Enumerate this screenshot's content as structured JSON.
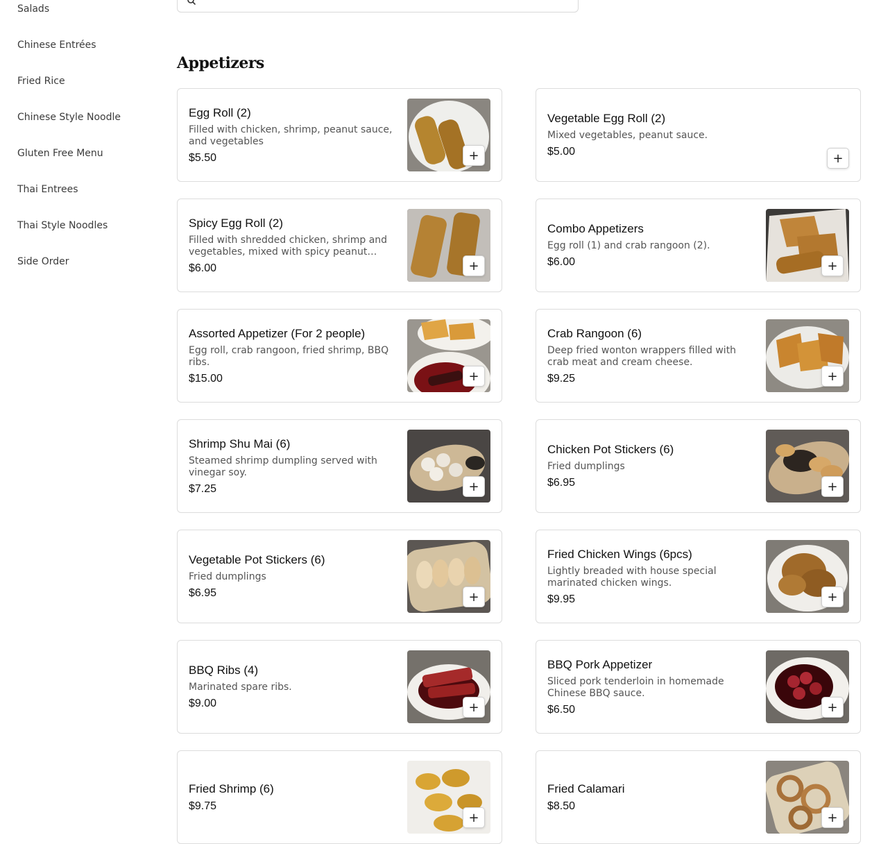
{
  "sidebar": {
    "items": [
      {
        "label": "Salads"
      },
      {
        "label": "Chinese Entrées"
      },
      {
        "label": "Fried Rice"
      },
      {
        "label": "Chinese Style Noodle"
      },
      {
        "label": "Gluten Free Menu"
      },
      {
        "label": "Thai Entrees"
      },
      {
        "label": "Thai Style Noodles"
      },
      {
        "label": "Side Order"
      }
    ]
  },
  "search": {
    "icon": "search-icon"
  },
  "section": {
    "title": "Appetizers"
  },
  "add_button": {
    "label": "+",
    "icon": "plus-icon"
  },
  "items": [
    {
      "name": "Egg Roll (2)",
      "desc": "Filled with chicken, shrimp, peanut sauce, and vegetables",
      "price": "$5.50",
      "image": "egg-roll-photo"
    },
    {
      "name": "Vegetable Egg Roll (2)",
      "desc": "Mixed vegetables, peanut sauce.",
      "price": "$5.00",
      "image": ""
    },
    {
      "name": "Spicy Egg Roll (2)",
      "desc": "Filled with shredded chicken, shrimp and vegetables, mixed with spicy peanut sauce",
      "price": "$6.00",
      "image": "spicy-egg-roll-photo"
    },
    {
      "name": "Combo Appetizers",
      "desc": "Egg roll (1) and crab rangoon (2).",
      "price": "$6.00",
      "image": "combo-appetizers-photo"
    },
    {
      "name": "Assorted Appetizer (For 2 people)",
      "desc": "Egg roll, crab rangoon, fried shrimp, BBQ ribs.",
      "price": "$15.00",
      "image": "assorted-appetizer-photo"
    },
    {
      "name": "Crab Rangoon (6)",
      "desc": "Deep fried wonton wrappers filled with crab meat and cream cheese.",
      "price": "$9.25",
      "image": "crab-rangoon-photo"
    },
    {
      "name": "Shrimp Shu Mai (6)",
      "desc": "Steamed shrimp dumpling served with vinegar soy.",
      "price": "$7.25",
      "image": "shrimp-shu-mai-photo"
    },
    {
      "name": "Chicken Pot Stickers (6)",
      "desc": "Fried dumplings",
      "price": "$6.95",
      "image": "chicken-pot-stickers-photo"
    },
    {
      "name": "Vegetable Pot Stickers (6)",
      "desc": "Fried dumplings",
      "price": "$6.95",
      "image": "vegetable-pot-stickers-photo"
    },
    {
      "name": "Fried Chicken Wings (6pcs)",
      "desc": "Lightly breaded with house special marinated chicken wings.",
      "price": "$9.95",
      "image": "fried-chicken-wings-photo"
    },
    {
      "name": "BBQ Ribs (4)",
      "desc": "Marinated spare ribs.",
      "price": "$9.00",
      "image": "bbq-ribs-photo"
    },
    {
      "name": "BBQ Pork Appetizer",
      "desc": "Sliced pork tenderloin in homemade Chinese BBQ sauce.",
      "price": "$6.50",
      "image": "bbq-pork-photo"
    },
    {
      "name": "Fried Shrimp (6)",
      "desc": "",
      "price": "$9.75",
      "image": "fried-shrimp-photo"
    },
    {
      "name": "Fried Calamari",
      "desc": "",
      "price": "$8.50",
      "image": "fried-calamari-photo"
    }
  ]
}
